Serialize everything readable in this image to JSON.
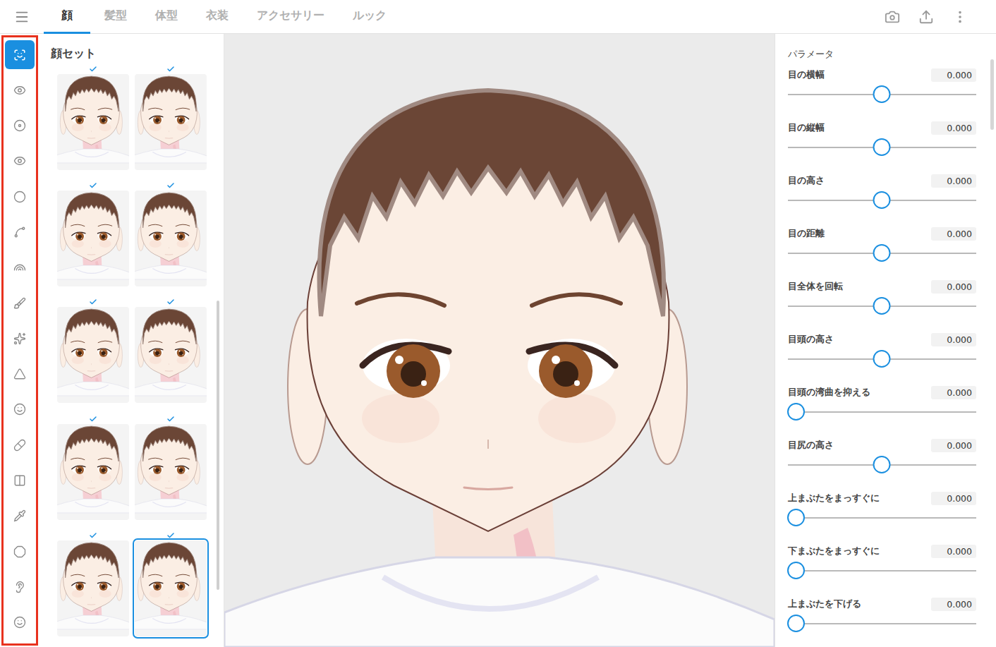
{
  "tabs": [
    {
      "label": "顔",
      "selected": true
    },
    {
      "label": "髪型",
      "selected": false
    },
    {
      "label": "体型",
      "selected": false
    },
    {
      "label": "衣装",
      "selected": false
    },
    {
      "label": "アクセサリー",
      "selected": false
    },
    {
      "label": "ルック",
      "selected": false
    }
  ],
  "sidebar": {
    "items": [
      {
        "selected": true
      },
      {
        "selected": false
      },
      {
        "selected": false
      },
      {
        "selected": false
      },
      {
        "selected": false
      },
      {
        "selected": false
      },
      {
        "selected": false
      },
      {
        "selected": false
      },
      {
        "selected": false
      },
      {
        "selected": false
      },
      {
        "selected": false
      },
      {
        "selected": false
      },
      {
        "selected": false
      },
      {
        "selected": false
      },
      {
        "selected": false
      },
      {
        "selected": false
      },
      {
        "selected": false
      }
    ]
  },
  "face_sets": {
    "title": "顔セット",
    "items": [
      {
        "checked": true,
        "selected": false
      },
      {
        "checked": true,
        "selected": false
      },
      {
        "checked": true,
        "selected": false
      },
      {
        "checked": true,
        "selected": false
      },
      {
        "checked": true,
        "selected": false
      },
      {
        "checked": true,
        "selected": false
      },
      {
        "checked": true,
        "selected": false
      },
      {
        "checked": true,
        "selected": false
      },
      {
        "checked": true,
        "selected": false
      },
      {
        "checked": true,
        "selected": true
      }
    ]
  },
  "parameters": {
    "title": "パラメータ",
    "items": [
      {
        "label": "目の横幅",
        "value": "0.000",
        "level": 0.5
      },
      {
        "label": "目の縦幅",
        "value": "0.000",
        "level": 0.5
      },
      {
        "label": "目の高さ",
        "value": "0.000",
        "level": 0.5
      },
      {
        "label": "目の距離",
        "value": "0.000",
        "level": 0.5
      },
      {
        "label": "目全体を回転",
        "value": "0.000",
        "level": 0.5
      },
      {
        "label": "目頭の高さ",
        "value": "0.000",
        "level": 0.5
      },
      {
        "label": "目頭の湾曲を抑える",
        "value": "0.000",
        "level": 0
      },
      {
        "label": "目尻の高さ",
        "value": "0.000",
        "level": 0.5
      },
      {
        "label": "上まぶたをまっすぐに",
        "value": "0.000",
        "level": 0
      },
      {
        "label": "下まぶたをまっすぐに",
        "value": "0.000",
        "level": 0
      },
      {
        "label": "上まぶたを下げる",
        "value": "0.000",
        "level": 0
      }
    ]
  }
}
